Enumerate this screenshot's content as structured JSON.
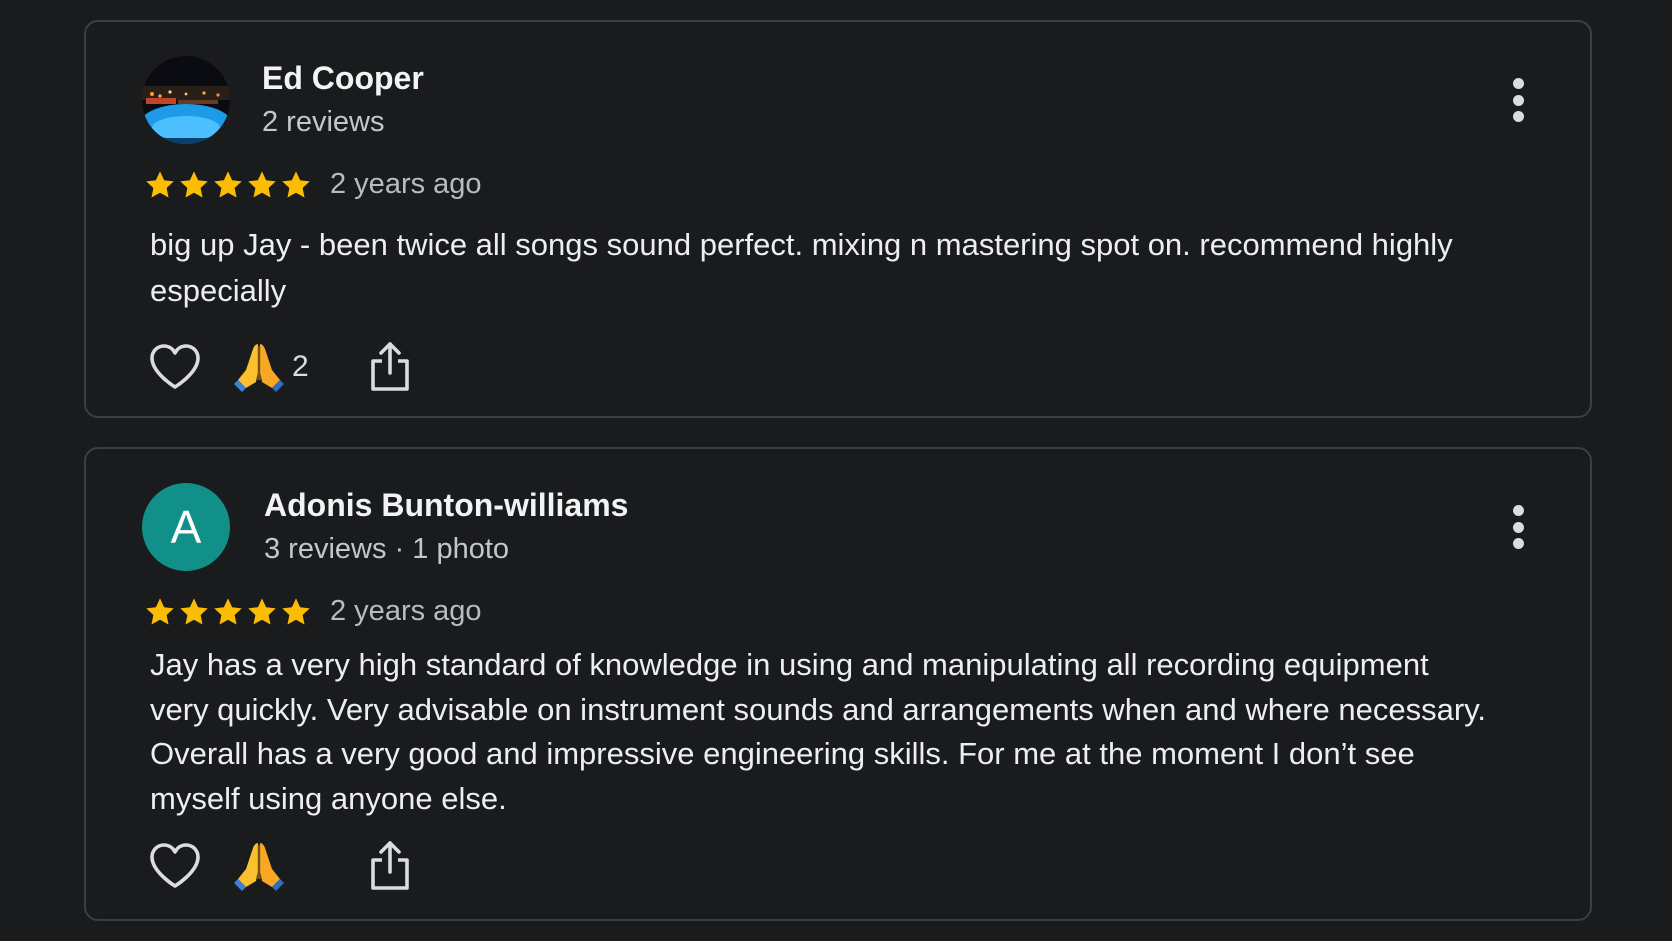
{
  "reviews": [
    {
      "name": "Ed Cooper",
      "meta": "2 reviews",
      "rating": 5,
      "time": "2 years ago",
      "text": "big up Jay - been twice all songs sound perfect. mixing n mastering spot on. recommend highly especially",
      "reaction_count": "2",
      "avatar": "photo"
    },
    {
      "name": "Adonis Bunton-williams",
      "meta": "3 reviews · 1 photo",
      "rating": 5,
      "time": "2 years ago",
      "text": "Jay has a very high standard of knowledge in using and manipulating all recording equipment very quickly. Very advisable on instrument sounds and arrangements when and where necessary. Overall has a very good and impressive engineering skills. For me at the moment I don’t see myself using anyone else.",
      "reaction_count": "",
      "avatar": "letter",
      "avatar_letter": "A"
    }
  ],
  "colors": {
    "background": "#1a1b1d",
    "star": "#fbbc04",
    "avatar_letter_bg": "#11908a"
  },
  "icons": [
    "heart-icon",
    "folded-hands-icon",
    "share-icon",
    "more-vert-icon",
    "star-icon"
  ]
}
